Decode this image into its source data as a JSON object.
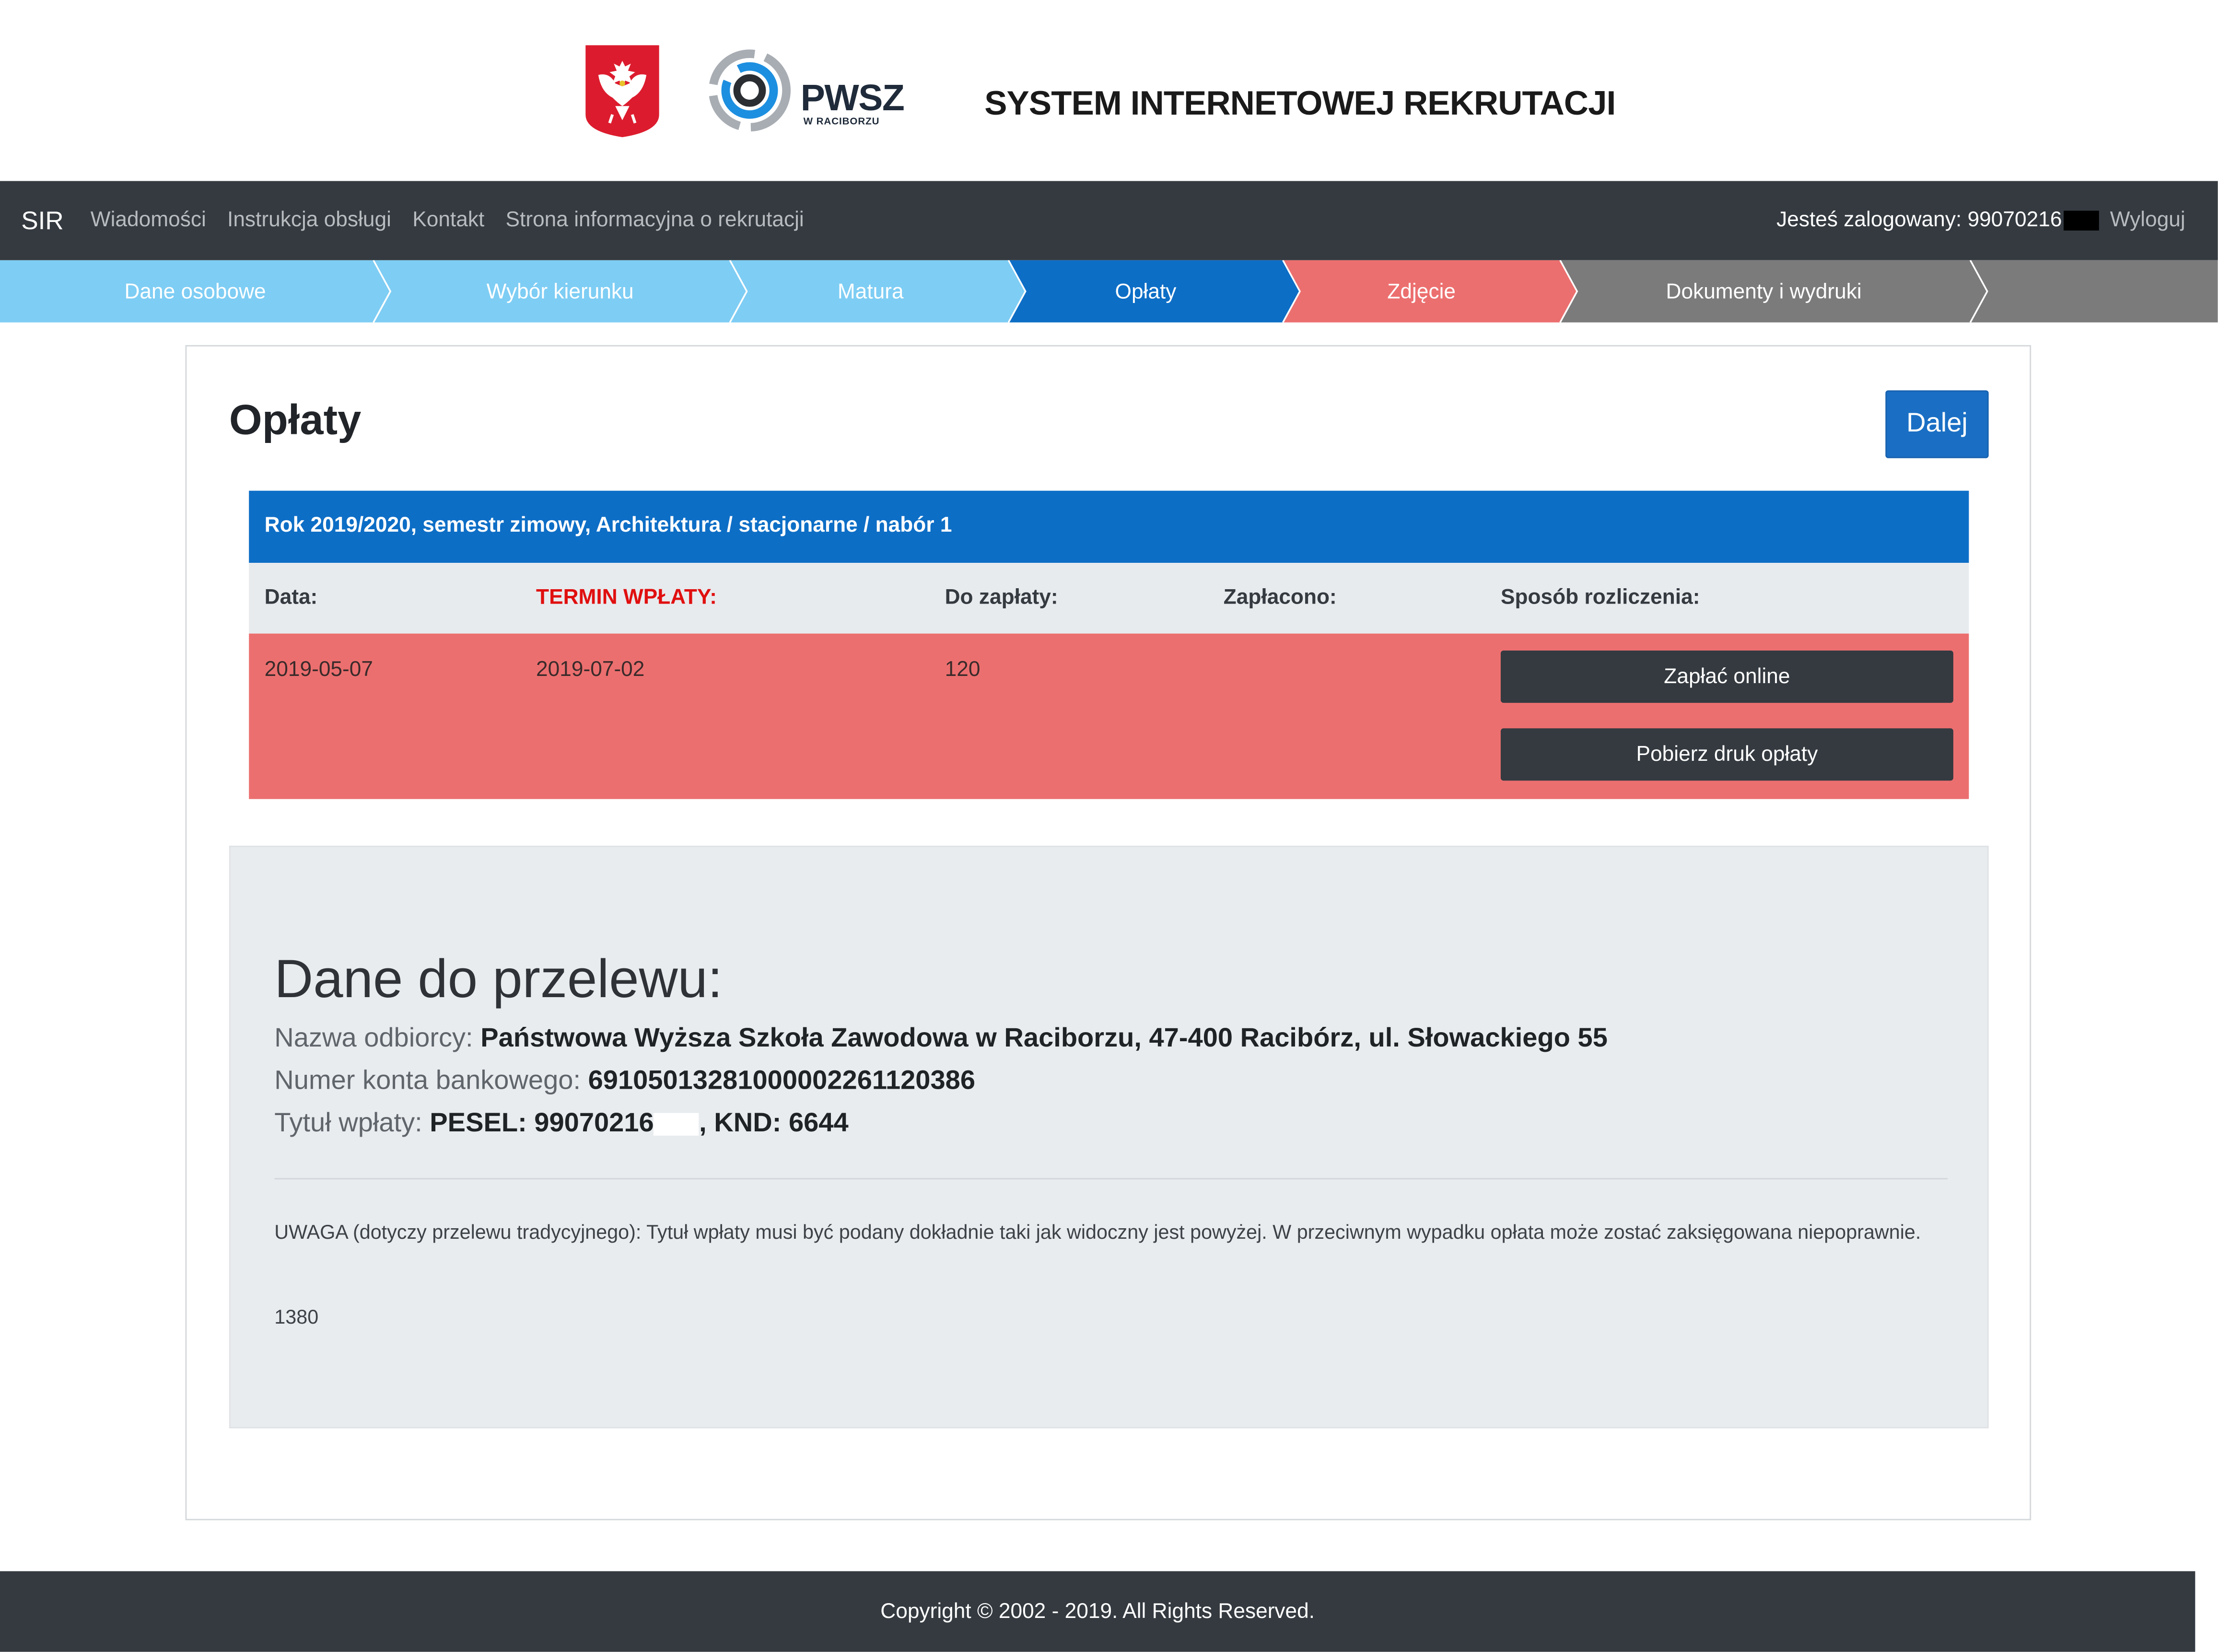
{
  "header": {
    "logo_text": "PWSZ",
    "logo_subtext": "W RACIBORZU",
    "system_title": "SYSTEM INTERNETOWEJ REKRUTACJI"
  },
  "navbar": {
    "brand": "SIR",
    "links": [
      "Wiadomości",
      "Instrukcja obsługi",
      "Kontakt",
      "Strona informacyjna o rekrutacji"
    ],
    "logged_in_text": "Jesteś zalogowany: 99070216",
    "logout_label": "Wyloguj"
  },
  "steps": [
    {
      "label": "Dane osobowe",
      "state": "done",
      "color": "#7ecdf4"
    },
    {
      "label": "Wybór kierunku",
      "state": "done",
      "color": "#7ecdf4"
    },
    {
      "label": "Matura",
      "state": "done",
      "color": "#7ecdf4"
    },
    {
      "label": "Opłaty",
      "state": "active",
      "color": "#0d6ec6"
    },
    {
      "label": "Zdjęcie",
      "state": "error",
      "color": "#ec6f6f"
    },
    {
      "label": "Dokumenty i wydruki",
      "state": "pending",
      "color": "#7b7b7b"
    }
  ],
  "main": {
    "title": "Opłaty",
    "next_button": "Dalej",
    "payment_table": {
      "heading": "Rok 2019/2020, semestr zimowy, Architektura / stacjonarne / nabór 1",
      "columns": [
        "Data:",
        "TERMIN WPŁATY:",
        "Do zapłaty:",
        "Zapłacono:",
        "Sposób rozliczenia:"
      ],
      "rows": [
        {
          "date": "2019-05-07",
          "deadline": "2019-07-02",
          "amount": "120",
          "paid": ""
        }
      ],
      "pay_online_button": "Zapłać online",
      "download_button": "Pobierz druk opłaty"
    },
    "transfer": {
      "title": "Dane do przelewu:",
      "recipient_label": "Nazwa odbiorcy:",
      "recipient_value": "Państwowa Wyższa Szkoła Zawodowa w Raciborzu, 47-400 Racibórz, ul. Słowackiego 55",
      "account_label": "Numer konta bankowego:",
      "account_value": "69105013281000002261120386",
      "title_label": "Tytuł wpłaty:",
      "title_value_prefix": "PESEL: 99070216",
      "title_value_suffix": ", KND: 6644",
      "note": "UWAGA (dotyczy przelewu tradycyjnego): Tytuł wpłaty musi być podany dokładnie taki jak widoczny jest powyżej. W przeciwnym wypadku opłata może zostać zaksięgowana niepoprawnie.",
      "number": "1380"
    }
  },
  "footer": {
    "copyright": "Copyright © 2002 - 2019. All Rights Reserved."
  },
  "colors": {
    "navbar": "#343a40",
    "primary": "#0d6ec6",
    "error_row": "#ec6f6f",
    "step_done": "#7ecdf4",
    "step_pending": "#7b7b7b"
  }
}
